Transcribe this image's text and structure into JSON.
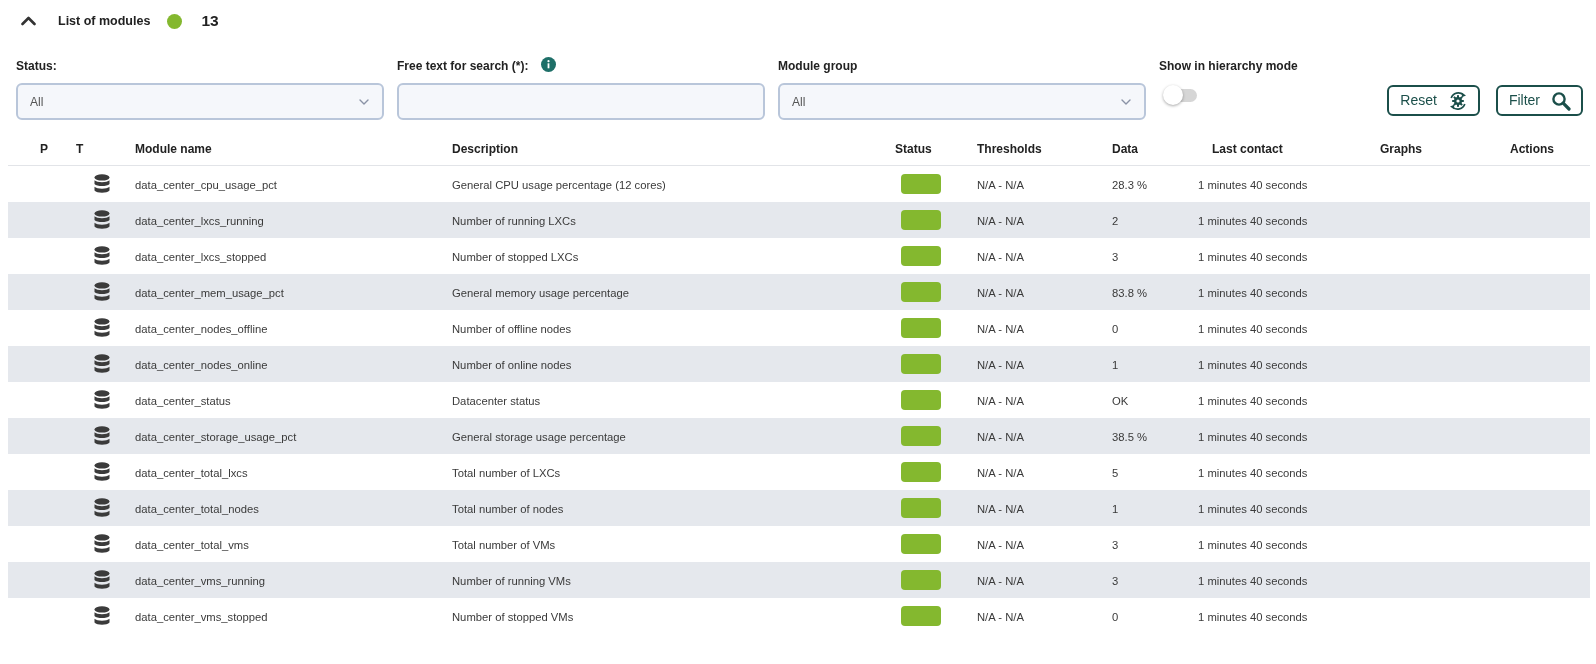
{
  "header": {
    "expanded": true,
    "title": "List of modules",
    "count": "13"
  },
  "filters": [
    {
      "kind": "select",
      "label": "Status:",
      "value": "All"
    },
    {
      "kind": "text",
      "label": "Free text for search (*):",
      "info": true
    },
    {
      "kind": "select",
      "label": "Module group",
      "value": "All"
    },
    {
      "kind": "toggle",
      "label": "Show in hierarchy mode",
      "on": false
    }
  ],
  "buttons": [
    {
      "kind": "reset",
      "label": "Reset"
    },
    {
      "kind": "filter",
      "label": "Filter"
    }
  ],
  "table": {
    "columns": [
      "P",
      "T",
      "Module name",
      "Description",
      "Status",
      "Thresholds",
      "Data",
      "Last contact",
      "Graphs",
      "Actions"
    ],
    "rows": [
      {
        "name": "data_center_cpu_usage_pct",
        "description": "General CPU usage percentage (12 cores)",
        "color": "#84b82f",
        "thresholds": "N/A - N/A",
        "data": "28.3 %",
        "last_contact": "1 minutes 40 seconds"
      },
      {
        "name": "data_center_lxcs_running",
        "description": "Number of running LXCs",
        "color": "#84b82f",
        "thresholds": "N/A - N/A",
        "data": "2",
        "last_contact": "1 minutes 40 seconds"
      },
      {
        "name": "data_center_lxcs_stopped",
        "description": "Number of stopped LXCs",
        "color": "#84b82f",
        "thresholds": "N/A - N/A",
        "data": "3",
        "last_contact": "1 minutes 40 seconds"
      },
      {
        "name": "data_center_mem_usage_pct",
        "description": "General memory usage percentage",
        "color": "#84b82f",
        "thresholds": "N/A - N/A",
        "data": "83.8 %",
        "last_contact": "1 minutes 40 seconds"
      },
      {
        "name": "data_center_nodes_offline",
        "description": "Number of offline nodes",
        "color": "#84b82f",
        "thresholds": "N/A - N/A",
        "data": "0",
        "last_contact": "1 minutes 40 seconds"
      },
      {
        "name": "data_center_nodes_online",
        "description": "Number of online nodes",
        "color": "#84b82f",
        "thresholds": "N/A - N/A",
        "data": "1",
        "last_contact": "1 minutes 40 seconds"
      },
      {
        "name": "data_center_status",
        "description": "Datacenter status",
        "color": "#84b82f",
        "thresholds": "N/A - N/A",
        "data": "OK",
        "last_contact": "1 minutes 40 seconds"
      },
      {
        "name": "data_center_storage_usage_pct",
        "description": "General storage usage percentage",
        "color": "#84b82f",
        "thresholds": "N/A - N/A",
        "data": "38.5 %",
        "last_contact": "1 minutes 40 seconds"
      },
      {
        "name": "data_center_total_lxcs",
        "description": "Total number of LXCs",
        "color": "#84b82f",
        "thresholds": "N/A - N/A",
        "data": "5",
        "last_contact": "1 minutes 40 seconds"
      },
      {
        "name": "data_center_total_nodes",
        "description": "Total number of nodes",
        "color": "#84b82f",
        "thresholds": "N/A - N/A",
        "data": "1",
        "last_contact": "1 minutes 40 seconds"
      },
      {
        "name": "data_center_total_vms",
        "description": "Total number of VMs",
        "color": "#84b82f",
        "thresholds": "N/A - N/A",
        "data": "3",
        "last_contact": "1 minutes 40 seconds"
      },
      {
        "name": "data_center_vms_running",
        "description": "Number of running VMs",
        "color": "#84b82f",
        "thresholds": "N/A - N/A",
        "data": "3",
        "last_contact": "1 minutes 40 seconds"
      },
      {
        "name": "data_center_vms_stopped",
        "description": "Number of stopped VMs",
        "color": "#84b82f",
        "thresholds": "N/A - N/A",
        "data": "0",
        "last_contact": "1 minutes 40 seconds"
      }
    ]
  }
}
